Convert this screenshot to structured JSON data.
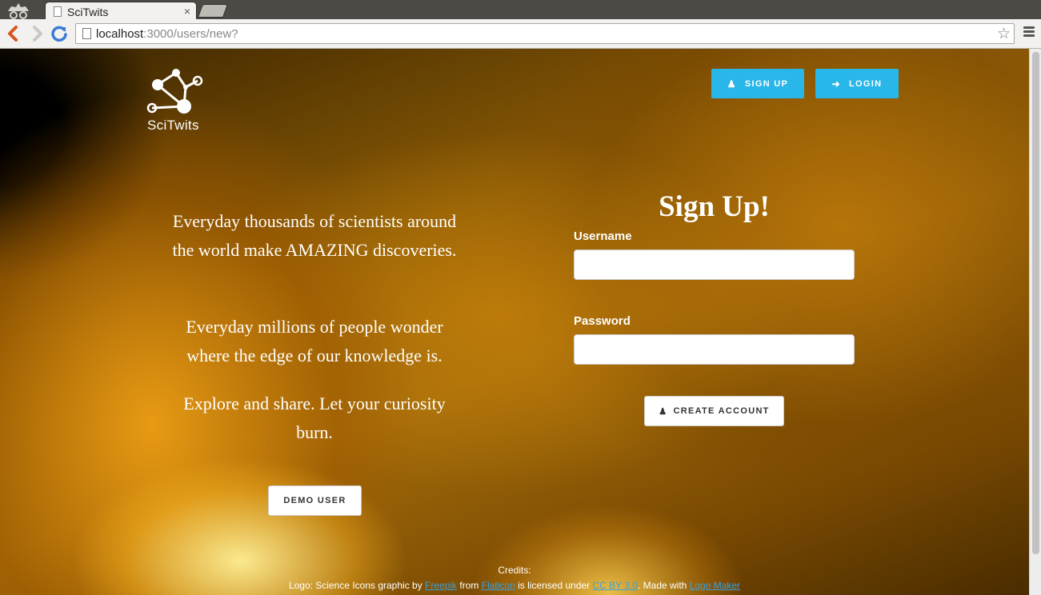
{
  "browser": {
    "tab_title": "SciTwits",
    "tab_close": "×",
    "url_host": "localhost",
    "url_path": ":3000/users/new?",
    "star": "☆"
  },
  "header": {
    "logo_text": "SciTwits",
    "signup_label": "SIGN UP",
    "signup_icon": "user-icon",
    "login_label": "LOGIN",
    "login_icon": "sign-in-icon"
  },
  "pitch": {
    "p1": "Everyday thousands of scientists around the world make AMAZING discoveries.",
    "p2": "Everyday millions of people wonder where the edge of our knowledge is.",
    "p3": "Explore and share. Let your curiosity burn."
  },
  "demo_button": "DEMO USER",
  "form": {
    "title": "Sign Up!",
    "username_label": "Username",
    "username_value": "",
    "password_label": "Password",
    "password_value": "",
    "create_label": "CREATE ACCOUNT"
  },
  "credits": {
    "heading": "Credits:",
    "prefix": "Logo: Science Icons graphic by ",
    "freepik": "Freepik",
    "from": " from ",
    "flaticon": "Flaticon",
    "licensed": " is licensed under ",
    "ccby": "CC BY 3.0",
    "made_with": ". Made with ",
    "logo_maker": "Logo Maker"
  },
  "colors": {
    "accent": "#29b6e8",
    "link": "#3aa0e0"
  }
}
